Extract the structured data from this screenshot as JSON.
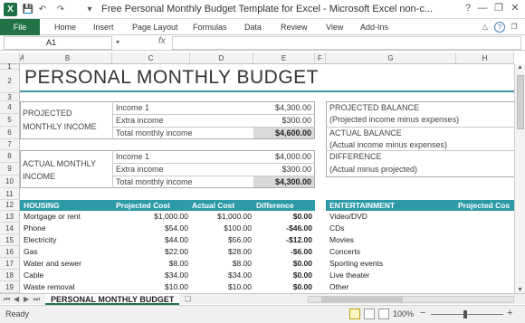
{
  "window": {
    "title": "Free Personal Monthly Budget Template for Excel  -  Microsoft Excel non-c...",
    "app_icon": "X",
    "quick_access": [
      "save-icon",
      "undo-icon",
      "redo-icon",
      "customize-icon"
    ],
    "controls": [
      "?",
      "—",
      "❐",
      "✕"
    ]
  },
  "ribbon": {
    "tabs": [
      "File",
      "Home",
      "Insert",
      "Page Layout",
      "Formulas",
      "Data",
      "Review",
      "View",
      "Add-Ins"
    ]
  },
  "formula_bar": {
    "name_box": "A1",
    "fx": "fx",
    "value": ""
  },
  "columns": [
    "A",
    "B",
    "C",
    "D",
    "E",
    "F",
    "G",
    "H"
  ],
  "rows": [
    "1",
    "2",
    "3",
    "4",
    "5",
    "6",
    "7",
    "8",
    "9",
    "10",
    "11",
    "12",
    "13",
    "14",
    "15",
    "16",
    "17",
    "18",
    "19"
  ],
  "sheet": {
    "title": "PERSONAL MONTHLY BUDGET",
    "projected": {
      "label_line1": "PROJECTED",
      "label_line2": "MONTHLY INCOME",
      "rows": [
        {
          "label": "Income 1",
          "value": "$4,300.00"
        },
        {
          "label": "Extra income",
          "value": "$300.00"
        },
        {
          "label": "Total monthly income",
          "value": "$4,600.00"
        }
      ]
    },
    "actual": {
      "label_line1": "ACTUAL MONTHLY",
      "label_line2": "INCOME",
      "rows": [
        {
          "label": "Income 1",
          "value": "$4,000.00"
        },
        {
          "label": "Extra income",
          "value": "$300.00"
        },
        {
          "label": "Total monthly income",
          "value": "$4,300.00"
        }
      ]
    },
    "balance": {
      "lines": [
        "PROJECTED BALANCE",
        "(Projected income minus expenses)",
        "ACTUAL BALANCE",
        "(Actual income minus expenses)",
        "DIFFERENCE",
        "(Actual minus projected)"
      ]
    },
    "housing": {
      "headers": [
        "HOUSING",
        "Projected Cost",
        "Actual Cost",
        "Difference"
      ],
      "rows": [
        [
          "Mortgage or rent",
          "$1,000.00",
          "$1,000.00",
          "$0.00"
        ],
        [
          "Phone",
          "$54.00",
          "$100.00",
          "-$46.00"
        ],
        [
          "Electricity",
          "$44.00",
          "$56.00",
          "-$12.00"
        ],
        [
          "Gas",
          "$22.00",
          "$28.00",
          "-$6.00"
        ],
        [
          "Water and sewer",
          "$8.00",
          "$8.00",
          "$0.00"
        ],
        [
          "Cable",
          "$34.00",
          "$34.00",
          "$0.00"
        ],
        [
          "Waste removal",
          "$10.00",
          "$10.00",
          "$0.00"
        ]
      ]
    },
    "entertainment": {
      "headers": [
        "ENTERTAINMENT",
        "Projected Cos"
      ],
      "rows": [
        "Video/DVD",
        "CDs",
        "Movies",
        "Concerts",
        "Sporting events",
        "Live theater",
        "Other"
      ]
    }
  },
  "sheet_tabs": {
    "active": "PERSONAL MONTHLY BUDGET"
  },
  "status": {
    "text": "Ready",
    "zoom": "100%"
  },
  "colors": {
    "accent": "#2e9aa8",
    "excel_green": "#217346"
  }
}
